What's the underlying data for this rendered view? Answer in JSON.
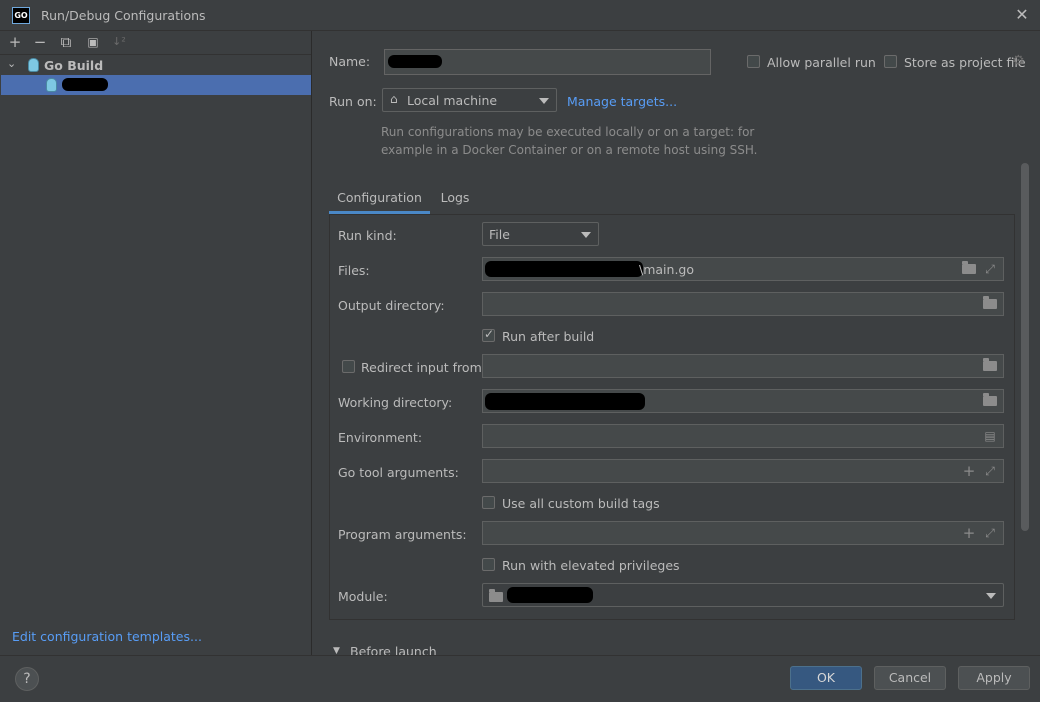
{
  "window": {
    "title": "Run/Debug Configurations",
    "app_icon_text": "GO"
  },
  "toolbar": {
    "add": "+",
    "remove": "−",
    "copy": "⧉",
    "folder": "▣",
    "sort": "↓²"
  },
  "tree": {
    "group_label": "Go Build"
  },
  "left_footer": {
    "edit_templates": "Edit configuration templates..."
  },
  "form": {
    "name_label": "Name:",
    "allow_parallel_label": "Allow parallel run",
    "store_project_label": "Store as project file",
    "run_on_label": "Run on:",
    "run_on_value": "Local machine",
    "manage_targets": "Manage targets...",
    "hint_line1": "Run configurations may be executed locally or on a target: for",
    "hint_line2": "example in a Docker Container or on a remote host using SSH."
  },
  "tabs": [
    {
      "label": "Configuration"
    },
    {
      "label": "Logs"
    }
  ],
  "config": {
    "run_kind_label": "Run kind:",
    "run_kind_value": "File",
    "files_label": "Files:",
    "files_value_suffix": "\\main.go",
    "output_dir_label": "Output directory:",
    "run_after_build_label": "Run after build",
    "redirect_input_label": "Redirect input from:",
    "working_dir_label": "Working directory:",
    "environment_label": "Environment:",
    "go_tool_args_label": "Go tool arguments:",
    "use_custom_tags_label": "Use all custom build tags",
    "program_args_label": "Program arguments:",
    "run_elevated_label": "Run with elevated privileges",
    "module_label": "Module:",
    "before_launch_label": "Before launch"
  },
  "buttons": {
    "help": "?",
    "ok": "OK",
    "cancel": "Cancel",
    "apply": "Apply"
  }
}
